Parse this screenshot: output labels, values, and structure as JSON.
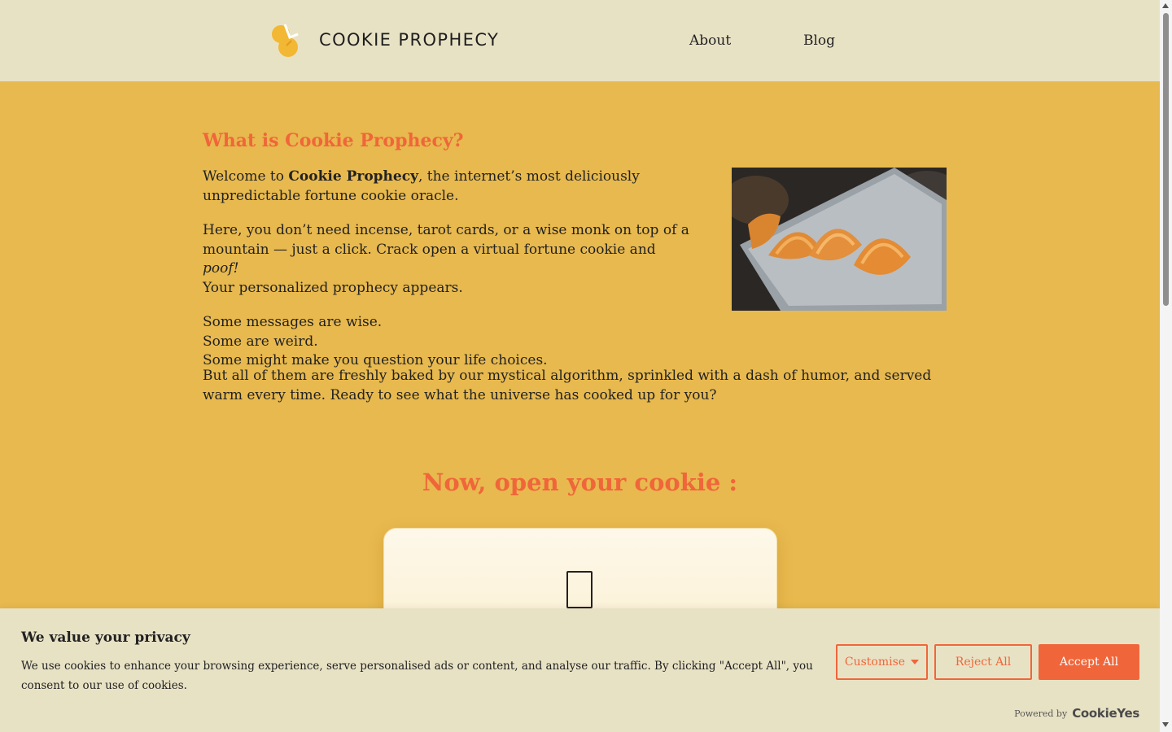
{
  "header": {
    "brand": "COOKIE PROPHECY",
    "nav": [
      {
        "label": "About"
      },
      {
        "label": "Blog"
      }
    ]
  },
  "main": {
    "section_title": "What is Cookie Prophecy?",
    "intro": {
      "p1_prefix": "Welcome to ",
      "p1_bold": "Cookie Prophecy",
      "p1_suffix": ", the internet’s most deliciously",
      "p1_line2": "unpredictable fortune cookie oracle.",
      "p2_line1": "Here, you don’t need incense, tarot cards, or a wise monk on top of a",
      "p2_line2_prefix": "mountain — just a click. Crack open a virtual fortune cookie and ",
      "p2_line2_italic": "poof!",
      "p2_line3": "Your personalized prophecy appears.",
      "p3_lines": [
        "Some messages are wise.",
        "Some are weird.",
        "Some might make you question your life choices."
      ]
    },
    "last_paragraph": "But all of them are freshly baked by our mystical algorithm, sprinkled with a dash of humor, and served warm every time. Ready to see what the universe has cooked up for you?",
    "open_title": "Now, open your cookie :"
  },
  "cookie_banner": {
    "title": "We value your privacy",
    "description": "We use cookies to enhance your browsing experience, serve personalised ads or content, and analyse our traffic. By clicking \"Accept All\", you consent to our use of cookies.",
    "customise_label": "Customise",
    "reject_label": "Reject All",
    "accept_label": "Accept All",
    "powered_by": "Powered by",
    "powered_brand": "CookieYes"
  },
  "colors": {
    "accent": "#f0663a",
    "background": "#e8b94e",
    "header_bg": "#e8e2c5"
  }
}
